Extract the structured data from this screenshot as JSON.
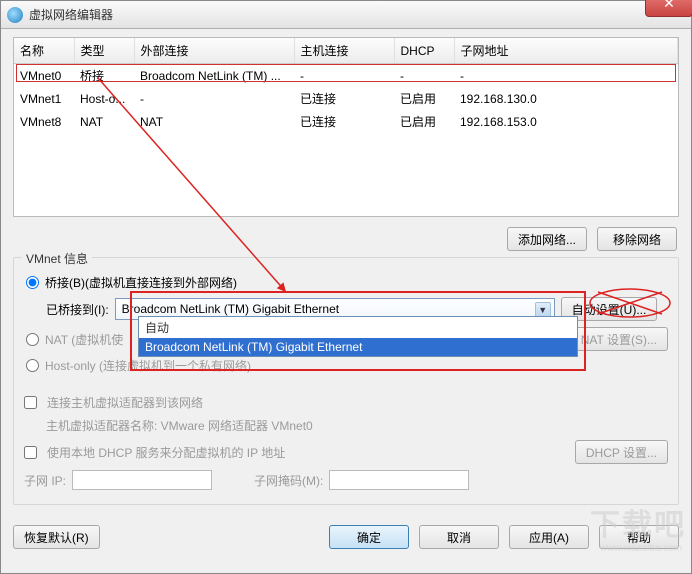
{
  "window": {
    "title": "虚拟网络编辑器"
  },
  "table": {
    "headers": [
      "名称",
      "类型",
      "外部连接",
      "主机连接",
      "DHCP",
      "子网地址"
    ],
    "rows": [
      {
        "name": "VMnet0",
        "type": "桥接",
        "ext": "Broadcom NetLink (TM) ...",
        "host": "-",
        "dhcp": "-",
        "subnet": "-"
      },
      {
        "name": "VMnet1",
        "type": "Host-o...",
        "ext": "-",
        "host": "已连接",
        "dhcp": "已启用",
        "subnet": "192.168.130.0"
      },
      {
        "name": "VMnet8",
        "type": "NAT",
        "ext": "NAT",
        "host": "已连接",
        "dhcp": "已启用",
        "subnet": "192.168.153.0"
      }
    ]
  },
  "buttons": {
    "addNetwork": "添加网络...",
    "removeNetwork": "移除网络"
  },
  "vmnetInfo": {
    "title": "VMnet 信息",
    "bridge": "桥接(B)(虚拟机直接连接到外部网络)",
    "bridgeTo": "已桥接到(I):",
    "bridgeValue": "Broadcom NetLink (TM) Gigabit Ethernet",
    "dropdown": {
      "opt1": "自动",
      "opt2": "Broadcom NetLink (TM) Gigabit Ethernet"
    },
    "autoSettings": "自动设置(U)...",
    "nat": "NAT (虚拟机使",
    "natSettings": "NAT 设置(S)...",
    "hostOnly": "Host-only (连接虚拟机到一个私有网络)",
    "connHostAdapter": "连接主机虚拟适配器到该网络",
    "hostAdapterLabel": "主机虚拟适配器名称: VMware 网络适配器 VMnet0",
    "useDhcp": "使用本地 DHCP 服务来分配虚拟机的 IP 地址",
    "dhcpSettings": "DHCP 设置...",
    "subnetIp": "子网 IP:",
    "subnetMask": "子网掩码(M):"
  },
  "footer": {
    "restore": "恢复默认(R)",
    "ok": "确定",
    "cancel": "取消",
    "apply": "应用(A)",
    "help": "帮助"
  },
  "watermark": {
    "text": "下载吧",
    "url": "www.xiazaiba.com"
  }
}
